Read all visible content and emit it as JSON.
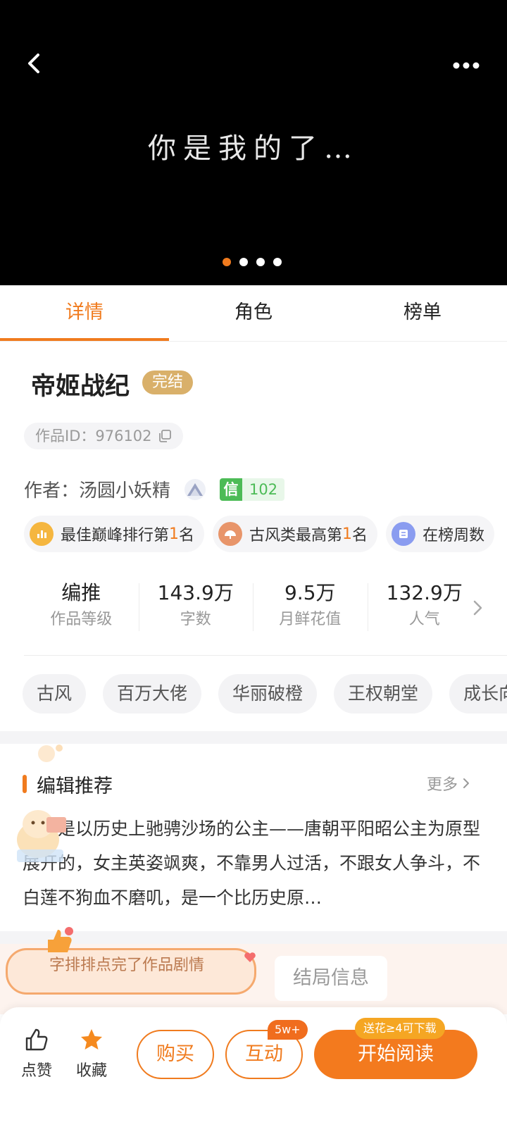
{
  "banner": {
    "caption": "你是我的了…",
    "slide_count": 4,
    "active_slide": 1
  },
  "tabs": [
    {
      "label": "详情",
      "active": true
    },
    {
      "label": "角色",
      "active": false
    },
    {
      "label": "榜单",
      "active": false
    }
  ],
  "book": {
    "title": "帝姬战纪",
    "status": "完结",
    "id_label": "作品ID：976102",
    "author_label": "作者：汤圆小妖精",
    "credit_label": "信",
    "credit_value": "102"
  },
  "achievements": [
    {
      "prefix": "最佳巅峰排行第",
      "highlight": "1",
      "suffix": "名",
      "icon": "chart-icon",
      "color": "#f5b63f"
    },
    {
      "prefix": "古风类最高第",
      "highlight": "1",
      "suffix": "名",
      "icon": "fan-icon",
      "color": "#e8956a"
    },
    {
      "prefix": "在榜周数",
      "highlight": "",
      "suffix": "",
      "icon": "list-icon",
      "color": "#8a9cf0"
    }
  ],
  "stats": [
    {
      "value": "编推",
      "label": "作品等级"
    },
    {
      "value": "143.9万",
      "label": "字数"
    },
    {
      "value": "9.5万",
      "label": "月鲜花值"
    },
    {
      "value": "132.9万",
      "label": "人气"
    }
  ],
  "tags": [
    "古风",
    "百万大佬",
    "华丽破橙",
    "王权朝堂",
    "成长向"
  ],
  "recommendation": {
    "title": "编辑推荐",
    "more": "更多",
    "body": "本作是以历史上驰骋沙场的公主——唐朝平阳昭公主为原型展开的，女主英姿飒爽，不靠男人过活，不跟女人争斗，不白莲不狗血不磨叽，是一个比历史原…"
  },
  "lower": {
    "speech": "字排排点完了作品剧情",
    "ending_button": "结局信息"
  },
  "bottom_bar": {
    "like_label": "点赞",
    "favorite_label": "收藏",
    "buy_label": "购买",
    "interact_label": "互动",
    "interact_badge": "5w+",
    "read_label": "开始阅读",
    "read_badge": "送花≥4可下载"
  },
  "colors": {
    "accent": "#f07b1e",
    "status_badge": "#d9b06a",
    "credit_green": "#4cbb56"
  }
}
